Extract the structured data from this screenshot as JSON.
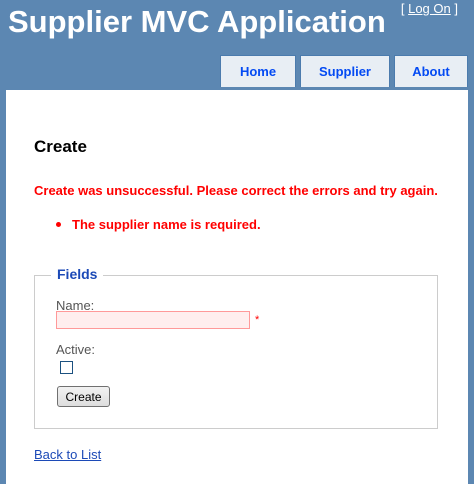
{
  "header": {
    "app_title": "Supplier MVC Application",
    "login_open_bracket": "[",
    "login_link": "Log On",
    "login_close_bracket": "]"
  },
  "menu": {
    "tabs": [
      {
        "label": "Home"
      },
      {
        "label": "Supplier"
      },
      {
        "label": "About"
      }
    ]
  },
  "main": {
    "title": "Create",
    "summary_error": "Create was unsuccessful. Please correct the errors and try again.",
    "errors": [
      "The supplier name is required."
    ],
    "fieldset": {
      "legend": "Fields",
      "name_label": "Name:",
      "name_value": "",
      "required_marker": "*",
      "active_label": "Active:",
      "active_checked": false,
      "create_button": "Create"
    },
    "back_link": "Back to List"
  },
  "colors": {
    "page_background": "#5c87b2",
    "error": "#ff0000",
    "link": "#1c4ab7",
    "tab_background": "#e8eef4"
  }
}
